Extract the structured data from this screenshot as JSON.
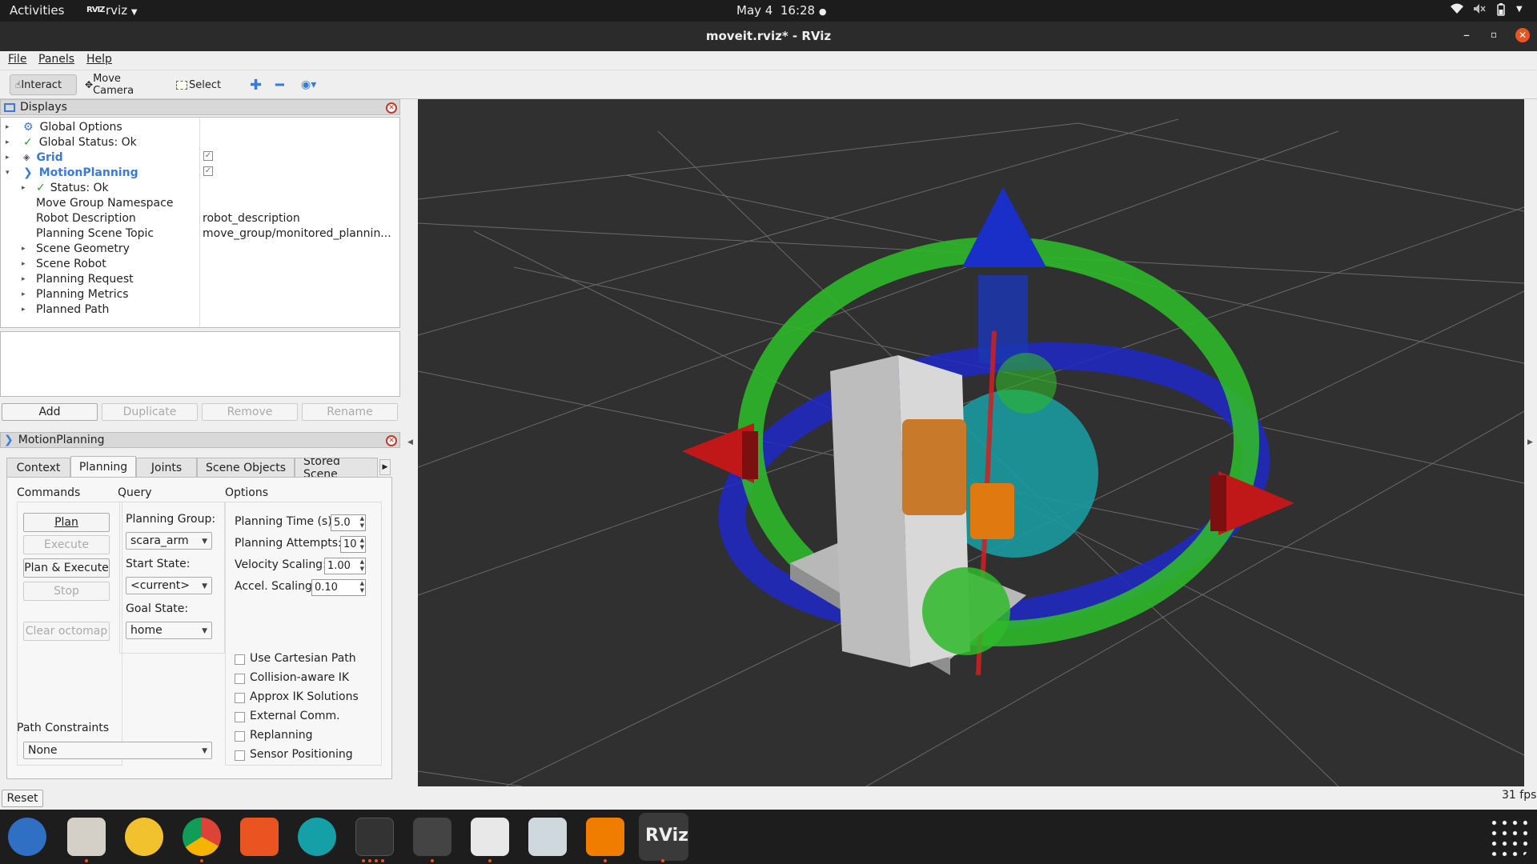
{
  "topbar": {
    "activities": "Activities",
    "app_name": "rviz",
    "app_logo": "RVIZ",
    "date": "May 4",
    "time": "16:28",
    "wifi_icon": "wifi-icon",
    "volume_icon": "volume-icon",
    "battery_icon": "battery-icon",
    "power_menu_icon": "chevron-down-icon"
  },
  "window": {
    "title": "moveit.rviz* - RViz"
  },
  "menu": [
    "File",
    "Panels",
    "Help"
  ],
  "toolbar": {
    "interact": "Interact",
    "move_camera": "Move Camera",
    "select": "Select"
  },
  "displays": {
    "title": "Displays",
    "rows": [
      {
        "label": "Global Options",
        "value": ""
      },
      {
        "label": "Global Status: Ok",
        "value": ""
      },
      {
        "label": "Grid",
        "value": ""
      },
      {
        "label": "MotionPlanning",
        "value": ""
      },
      {
        "label": "Status: Ok",
        "value": ""
      },
      {
        "label": "Move Group Namespace",
        "value": ""
      },
      {
        "label": "Robot Description",
        "value": "robot_description"
      },
      {
        "label": "Planning Scene Topic",
        "value": "move_group/monitored_plannin..."
      },
      {
        "label": "Scene Geometry",
        "value": ""
      },
      {
        "label": "Scene Robot",
        "value": ""
      },
      {
        "label": "Planning Request",
        "value": ""
      },
      {
        "label": "Planning Metrics",
        "value": ""
      },
      {
        "label": "Planned Path",
        "value": ""
      }
    ],
    "buttons": {
      "add": "Add",
      "duplicate": "Duplicate",
      "remove": "Remove",
      "rename": "Rename"
    }
  },
  "motion_planning": {
    "title": "MotionPlanning",
    "tabs": [
      "Context",
      "Planning",
      "Joints",
      "Scene Objects",
      "Stored Scene"
    ],
    "active_tab": "Planning",
    "commands": {
      "heading": "Commands",
      "plan": "Plan",
      "execute": "Execute",
      "plan_execute": "Plan & Execute",
      "stop": "Stop",
      "clear_octomap": "Clear octomap"
    },
    "query": {
      "heading": "Query",
      "planning_group_label": "Planning Group:",
      "planning_group_value": "scara_arm",
      "start_state_label": "Start State:",
      "start_state_value": "<current>",
      "goal_state_label": "Goal State:",
      "goal_state_value": "home"
    },
    "options": {
      "heading": "Options",
      "planning_time_label": "Planning Time (s):",
      "planning_time_value": "5.0",
      "planning_attempts_label": "Planning Attempts:",
      "planning_attempts_value": "10",
      "velocity_scaling_label": "Velocity Scaling:",
      "velocity_scaling_value": "1.00",
      "accel_scaling_label": "Accel. Scaling:",
      "accel_scaling_value": "0.10",
      "checkboxes": [
        "Use Cartesian Path",
        "Collision-aware IK",
        "Approx IK Solutions",
        "External Comm.",
        "Replanning",
        "Sensor Positioning"
      ]
    },
    "path_constraints": {
      "label": "Path Constraints",
      "value": "None"
    }
  },
  "status": {
    "reset": "Reset",
    "fps": "31 fps"
  },
  "dock": [
    "thunderbird-icon",
    "files-icon",
    "rhythmbox-icon",
    "chrome-icon",
    "app-center-icon",
    "arduino-icon",
    "terminal-icon",
    "sublime-text-icon",
    "text-editor-icon",
    "image-viewer-icon",
    "package-icon",
    "rviz-icon",
    "app-grid-icon"
  ],
  "dock_labels": {
    "rviz": "RViz"
  }
}
